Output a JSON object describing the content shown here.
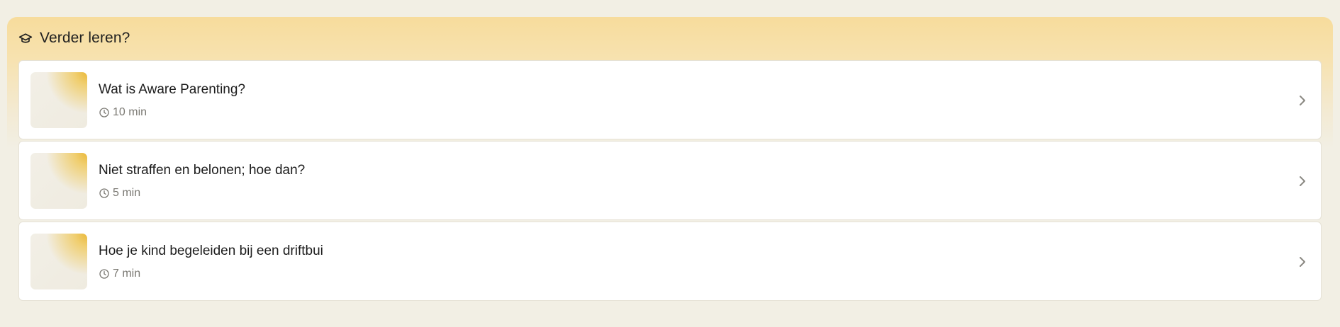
{
  "section": {
    "title": "Verder leren?",
    "icon": "graduation-cap-icon"
  },
  "colors": {
    "background": "#f2efe4",
    "header_gradient_top": "#f7dc9c",
    "card": "#ffffff",
    "thumb_accent": "#eab93a",
    "text": "#1c1c1c",
    "muted": "#7a7872"
  },
  "items": [
    {
      "title": "Wat is Aware Parenting?",
      "duration": "10 min"
    },
    {
      "title": "Niet straffen en belonen; hoe dan?",
      "duration": "5 min"
    },
    {
      "title": "Hoe je kind begeleiden bij een driftbui",
      "duration": "7 min"
    }
  ]
}
